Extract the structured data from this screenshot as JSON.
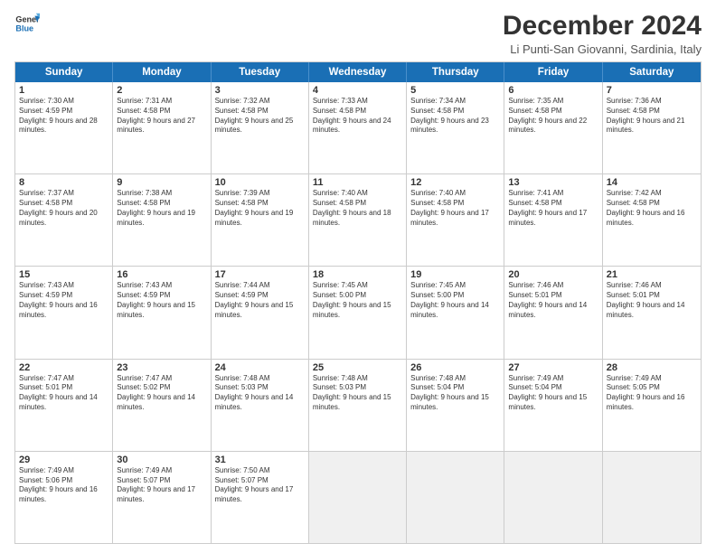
{
  "header": {
    "logo_line1": "General",
    "logo_line2": "Blue",
    "title": "December 2024",
    "location": "Li Punti-San Giovanni, Sardinia, Italy"
  },
  "weekdays": [
    "Sunday",
    "Monday",
    "Tuesday",
    "Wednesday",
    "Thursday",
    "Friday",
    "Saturday"
  ],
  "rows": [
    [
      {
        "day": "1",
        "sunrise": "Sunrise: 7:30 AM",
        "sunset": "Sunset: 4:59 PM",
        "daylight": "Daylight: 9 hours and 28 minutes."
      },
      {
        "day": "2",
        "sunrise": "Sunrise: 7:31 AM",
        "sunset": "Sunset: 4:58 PM",
        "daylight": "Daylight: 9 hours and 27 minutes."
      },
      {
        "day": "3",
        "sunrise": "Sunrise: 7:32 AM",
        "sunset": "Sunset: 4:58 PM",
        "daylight": "Daylight: 9 hours and 25 minutes."
      },
      {
        "day": "4",
        "sunrise": "Sunrise: 7:33 AM",
        "sunset": "Sunset: 4:58 PM",
        "daylight": "Daylight: 9 hours and 24 minutes."
      },
      {
        "day": "5",
        "sunrise": "Sunrise: 7:34 AM",
        "sunset": "Sunset: 4:58 PM",
        "daylight": "Daylight: 9 hours and 23 minutes."
      },
      {
        "day": "6",
        "sunrise": "Sunrise: 7:35 AM",
        "sunset": "Sunset: 4:58 PM",
        "daylight": "Daylight: 9 hours and 22 minutes."
      },
      {
        "day": "7",
        "sunrise": "Sunrise: 7:36 AM",
        "sunset": "Sunset: 4:58 PM",
        "daylight": "Daylight: 9 hours and 21 minutes."
      }
    ],
    [
      {
        "day": "8",
        "sunrise": "Sunrise: 7:37 AM",
        "sunset": "Sunset: 4:58 PM",
        "daylight": "Daylight: 9 hours and 20 minutes."
      },
      {
        "day": "9",
        "sunrise": "Sunrise: 7:38 AM",
        "sunset": "Sunset: 4:58 PM",
        "daylight": "Daylight: 9 hours and 19 minutes."
      },
      {
        "day": "10",
        "sunrise": "Sunrise: 7:39 AM",
        "sunset": "Sunset: 4:58 PM",
        "daylight": "Daylight: 9 hours and 19 minutes."
      },
      {
        "day": "11",
        "sunrise": "Sunrise: 7:40 AM",
        "sunset": "Sunset: 4:58 PM",
        "daylight": "Daylight: 9 hours and 18 minutes."
      },
      {
        "day": "12",
        "sunrise": "Sunrise: 7:40 AM",
        "sunset": "Sunset: 4:58 PM",
        "daylight": "Daylight: 9 hours and 17 minutes."
      },
      {
        "day": "13",
        "sunrise": "Sunrise: 7:41 AM",
        "sunset": "Sunset: 4:58 PM",
        "daylight": "Daylight: 9 hours and 17 minutes."
      },
      {
        "day": "14",
        "sunrise": "Sunrise: 7:42 AM",
        "sunset": "Sunset: 4:58 PM",
        "daylight": "Daylight: 9 hours and 16 minutes."
      }
    ],
    [
      {
        "day": "15",
        "sunrise": "Sunrise: 7:43 AM",
        "sunset": "Sunset: 4:59 PM",
        "daylight": "Daylight: 9 hours and 16 minutes."
      },
      {
        "day": "16",
        "sunrise": "Sunrise: 7:43 AM",
        "sunset": "Sunset: 4:59 PM",
        "daylight": "Daylight: 9 hours and 15 minutes."
      },
      {
        "day": "17",
        "sunrise": "Sunrise: 7:44 AM",
        "sunset": "Sunset: 4:59 PM",
        "daylight": "Daylight: 9 hours and 15 minutes."
      },
      {
        "day": "18",
        "sunrise": "Sunrise: 7:45 AM",
        "sunset": "Sunset: 5:00 PM",
        "daylight": "Daylight: 9 hours and 15 minutes."
      },
      {
        "day": "19",
        "sunrise": "Sunrise: 7:45 AM",
        "sunset": "Sunset: 5:00 PM",
        "daylight": "Daylight: 9 hours and 14 minutes."
      },
      {
        "day": "20",
        "sunrise": "Sunrise: 7:46 AM",
        "sunset": "Sunset: 5:01 PM",
        "daylight": "Daylight: 9 hours and 14 minutes."
      },
      {
        "day": "21",
        "sunrise": "Sunrise: 7:46 AM",
        "sunset": "Sunset: 5:01 PM",
        "daylight": "Daylight: 9 hours and 14 minutes."
      }
    ],
    [
      {
        "day": "22",
        "sunrise": "Sunrise: 7:47 AM",
        "sunset": "Sunset: 5:01 PM",
        "daylight": "Daylight: 9 hours and 14 minutes."
      },
      {
        "day": "23",
        "sunrise": "Sunrise: 7:47 AM",
        "sunset": "Sunset: 5:02 PM",
        "daylight": "Daylight: 9 hours and 14 minutes."
      },
      {
        "day": "24",
        "sunrise": "Sunrise: 7:48 AM",
        "sunset": "Sunset: 5:03 PM",
        "daylight": "Daylight: 9 hours and 14 minutes."
      },
      {
        "day": "25",
        "sunrise": "Sunrise: 7:48 AM",
        "sunset": "Sunset: 5:03 PM",
        "daylight": "Daylight: 9 hours and 15 minutes."
      },
      {
        "day": "26",
        "sunrise": "Sunrise: 7:48 AM",
        "sunset": "Sunset: 5:04 PM",
        "daylight": "Daylight: 9 hours and 15 minutes."
      },
      {
        "day": "27",
        "sunrise": "Sunrise: 7:49 AM",
        "sunset": "Sunset: 5:04 PM",
        "daylight": "Daylight: 9 hours and 15 minutes."
      },
      {
        "day": "28",
        "sunrise": "Sunrise: 7:49 AM",
        "sunset": "Sunset: 5:05 PM",
        "daylight": "Daylight: 9 hours and 16 minutes."
      }
    ],
    [
      {
        "day": "29",
        "sunrise": "Sunrise: 7:49 AM",
        "sunset": "Sunset: 5:06 PM",
        "daylight": "Daylight: 9 hours and 16 minutes."
      },
      {
        "day": "30",
        "sunrise": "Sunrise: 7:49 AM",
        "sunset": "Sunset: 5:07 PM",
        "daylight": "Daylight: 9 hours and 17 minutes."
      },
      {
        "day": "31",
        "sunrise": "Sunrise: 7:50 AM",
        "sunset": "Sunset: 5:07 PM",
        "daylight": "Daylight: 9 hours and 17 minutes."
      },
      null,
      null,
      null,
      null
    ]
  ]
}
